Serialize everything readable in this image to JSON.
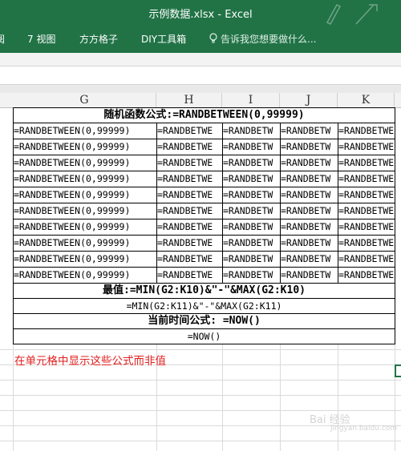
{
  "window": {
    "title": "示例数据.xlsx - Excel"
  },
  "ribbon": {
    "tabs": [
      {
        "label": "阅"
      },
      {
        "label": "7 视图"
      },
      {
        "label": "方方格子"
      },
      {
        "label": "DIY工具箱"
      }
    ],
    "tell_me": "告诉我您想要做什么..."
  },
  "columns": [
    "G",
    "H",
    "I",
    "J",
    "K"
  ],
  "table": {
    "header": "随机函数公式:=RANDBETWEEN(0,99999)",
    "rows": [
      [
        "=RANDBETWEEN(0,99999)",
        "=RANDBETWE",
        "=RANDBETW",
        "=RANDBETW",
        "=RANDBETWE"
      ],
      [
        "=RANDBETWEEN(0,99999)",
        "=RANDBETWE",
        "=RANDBETW",
        "=RANDBETW",
        "=RANDBETWE"
      ],
      [
        "=RANDBETWEEN(0,99999)",
        "=RANDBETWE",
        "=RANDBETW",
        "=RANDBETW",
        "=RANDBETWE"
      ],
      [
        "=RANDBETWEEN(0,99999)",
        "=RANDBETWE",
        "=RANDBETW",
        "=RANDBETW",
        "=RANDBETWE"
      ],
      [
        "=RANDBETWEEN(0,99999)",
        "=RANDBETWE",
        "=RANDBETW",
        "=RANDBETW",
        "=RANDBETWE"
      ],
      [
        "=RANDBETWEEN(0,99999)",
        "=RANDBETWE",
        "=RANDBETW",
        "=RANDBETW",
        "=RANDBETWE"
      ],
      [
        "=RANDBETWEEN(0,99999)",
        "=RANDBETWE",
        "=RANDBETW",
        "=RANDBETW",
        "=RANDBETWE"
      ],
      [
        "=RANDBETWEEN(0,99999)",
        "=RANDBETWE",
        "=RANDBETW",
        "=RANDBETW",
        "=RANDBETWE"
      ],
      [
        "=RANDBETWEEN(0,99999)",
        "=RANDBETWE",
        "=RANDBETW",
        "=RANDBETW",
        "=RANDBETWE"
      ],
      [
        "=RANDBETWEEN(0,99999)",
        "=RANDBETWE",
        "=RANDBETW",
        "=RANDBETW",
        "=RANDBETWE"
      ]
    ],
    "minmax_header": "最值:=MIN(G2:K10)&\"-\"&MAX(G2:K10)",
    "minmax_formula": "=MIN(G2:K11)&\"-\"&MAX(G2:K11)",
    "now_header": "当前时间公式: =NOW()",
    "now_formula": "=NOW()"
  },
  "note": "在单元格中显示这些公式而非值",
  "watermark": {
    "main": "Bai 经验",
    "sub": "jingyan.baidu.com"
  },
  "colors": {
    "excel_green": "#217346",
    "note_red": "#e02020"
  }
}
